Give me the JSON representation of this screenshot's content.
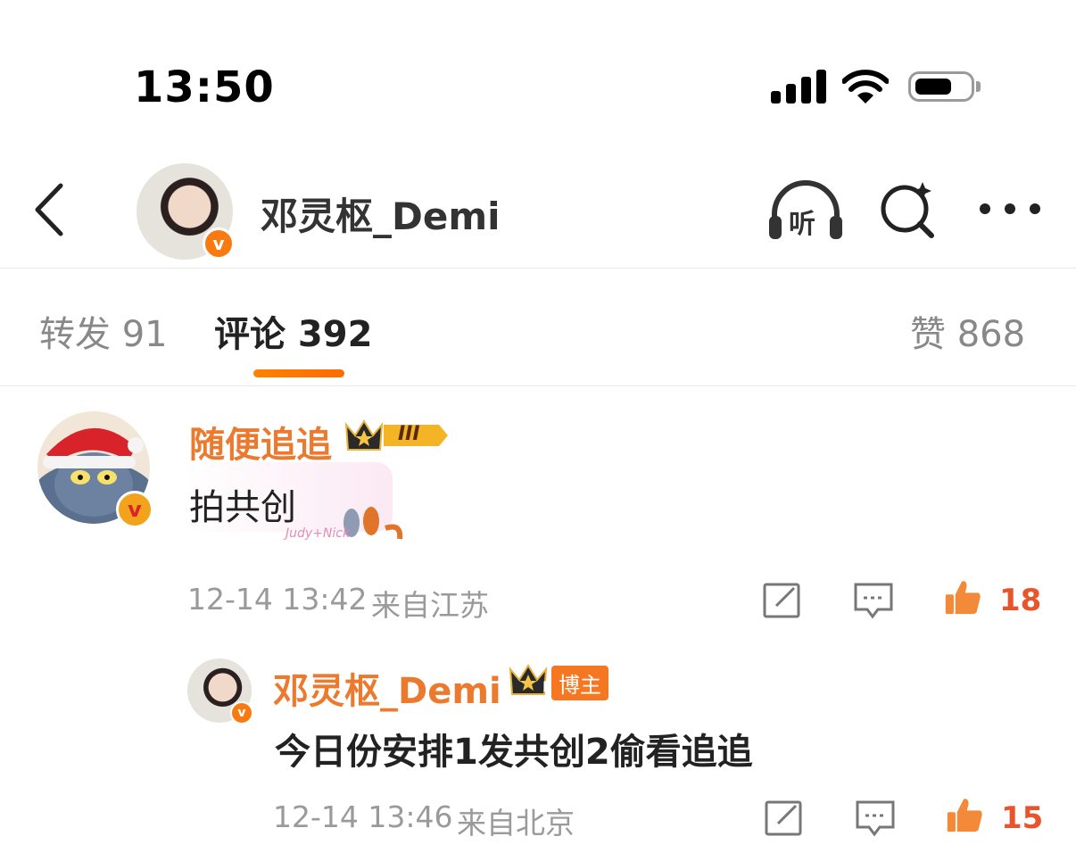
{
  "status_bar": {
    "time": "13:50"
  },
  "header": {
    "title": "邓灵枢_Demi",
    "listen_icon_label": "听"
  },
  "tabs": [
    {
      "label": "转发 91"
    },
    {
      "label": "评论 392"
    },
    {
      "label": "赞 868"
    }
  ],
  "comments": [
    {
      "username": "随便追追",
      "level_badge": "III",
      "text": "拍共创",
      "timestamp": "12-14 13:42",
      "location": "来自江苏",
      "likes": "18",
      "sticker_text": "Judy+Nick"
    }
  ],
  "replies": [
    {
      "username": "邓灵枢_Demi",
      "level_badge": "I",
      "tag": "博主",
      "text": "今日份安排1发共创2偷看追追",
      "timestamp": "12-14 13:46",
      "location": "来自北京",
      "likes": "15"
    }
  ],
  "verified_badge": "v",
  "colors": {
    "accent": "#ff8200",
    "username": "#eb7a2e",
    "like": "#e8552c"
  }
}
